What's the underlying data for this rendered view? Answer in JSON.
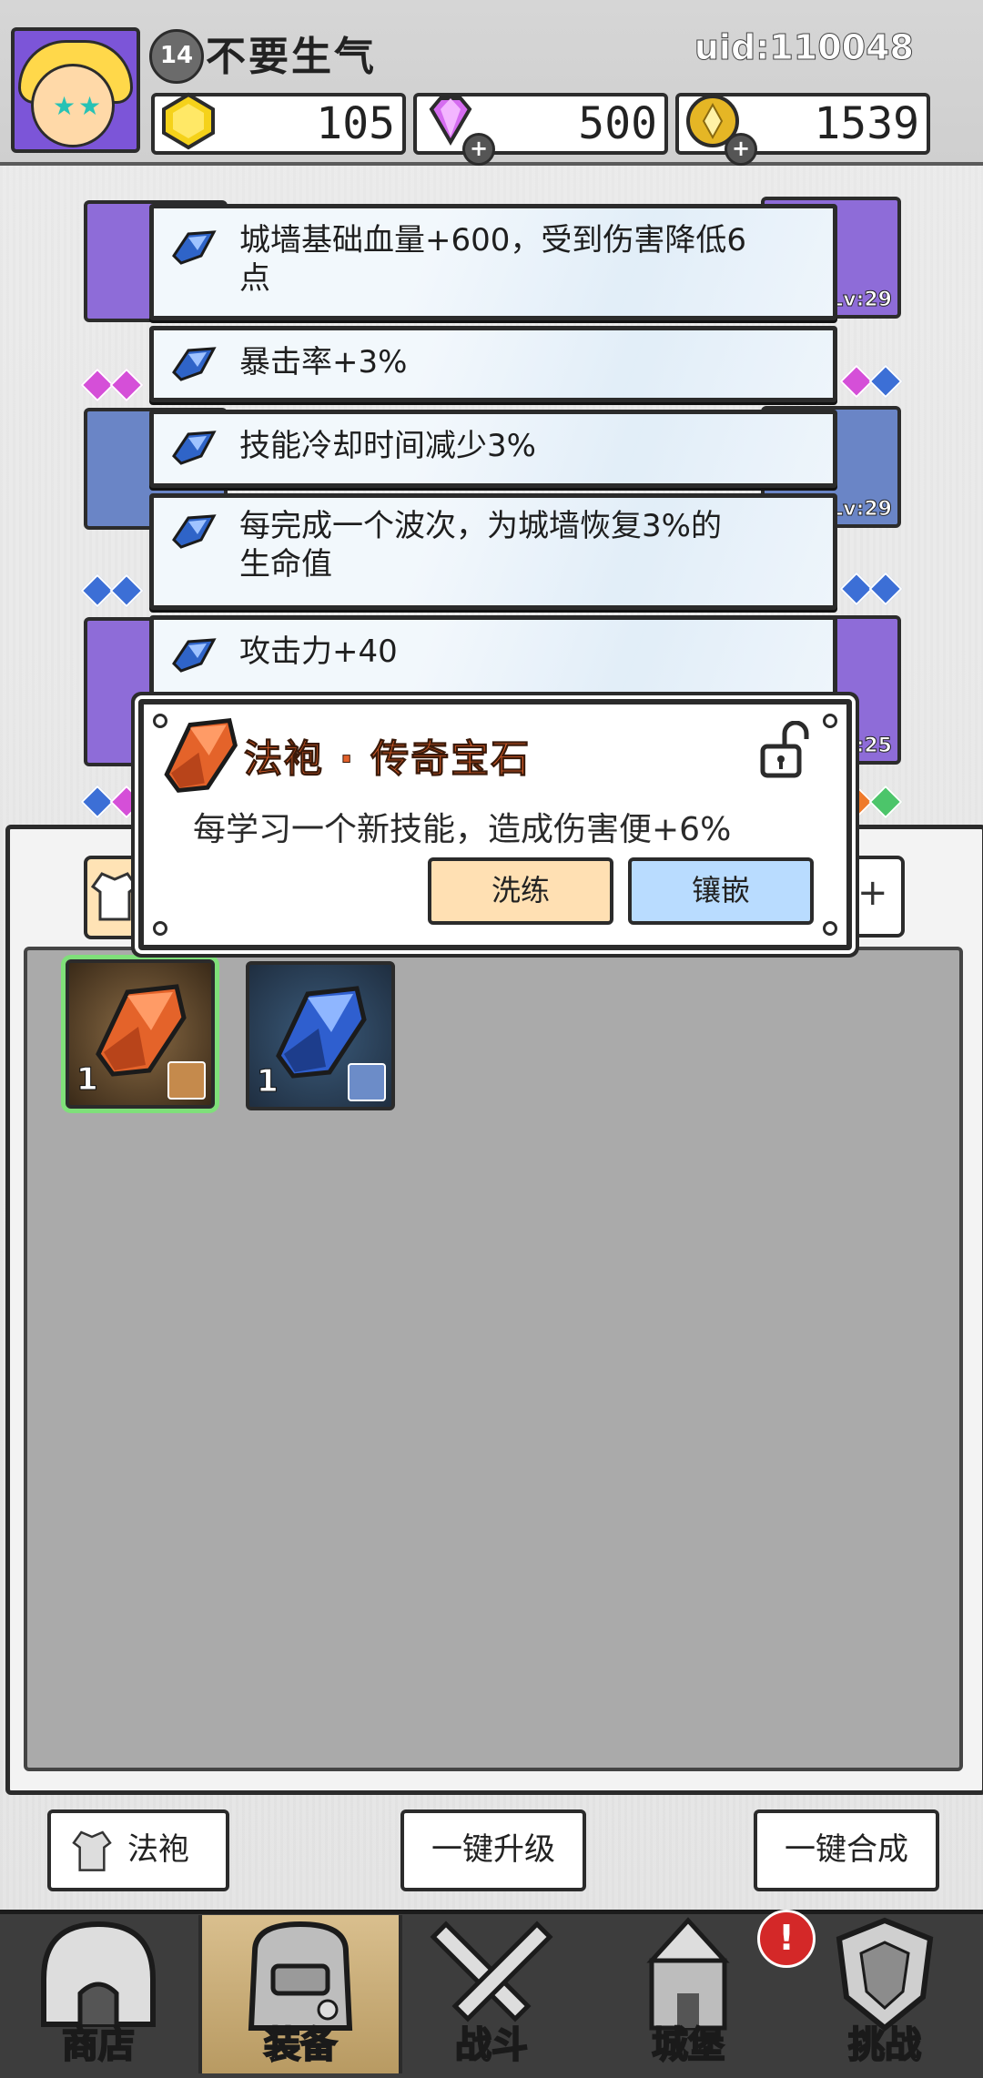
{
  "player": {
    "level": "14",
    "name": "不要生气",
    "uid": "uid:110048"
  },
  "currencies": [
    {
      "name": "gold-gem",
      "value": "105"
    },
    {
      "name": "diamond",
      "value": "500"
    },
    {
      "name": "coin",
      "value": "1539"
    }
  ],
  "slots": {
    "row1_right_lv": "Lv:29",
    "row2_right_lv": "Lv:29",
    "row3_right_lv": "Lv:25"
  },
  "stats": [
    "城墙基础血量+600，受到伤害降低6点",
    "暴击率+3%",
    "技能冷却时间减少3%",
    "每完成一个波次，为城墙恢复3%的生命值",
    "攻击力+40"
  ],
  "stat_lines": {
    "s1_line1": "城墙基础血量+600，受到伤害降低6",
    "s1_line2": "点",
    "s4_line1": "每完成一个波次，为城墙恢复3%的",
    "s4_line2": "生命值"
  },
  "tooltip": {
    "title": "法袍 · 传奇宝石",
    "description": "每学习一个新技能，造成伤害便+6%",
    "wash_label": "洗练",
    "inlay_label": "镶嵌"
  },
  "inventory": {
    "tab_right_symbol": "+",
    "items": [
      {
        "type": "orange-gem",
        "count": "1"
      },
      {
        "type": "blue-gem",
        "count": "1"
      }
    ]
  },
  "actions": {
    "robe_label": "法袍",
    "upgrade_all_label": "一键升级",
    "merge_all_label": "一键合成"
  },
  "nav": {
    "items": [
      "商店",
      "装备",
      "战斗",
      "城堡",
      "挑战"
    ],
    "active": "装备",
    "alert_symbol": "!"
  },
  "colors": {
    "accent_orange": "#e3612b",
    "wash_btn": "#ffe0b3",
    "inlay_btn": "#b9dcff",
    "slot_purple": "#8e6cd8",
    "slot_blue": "#6a85c6",
    "selected_outline": "#7fe07a"
  }
}
